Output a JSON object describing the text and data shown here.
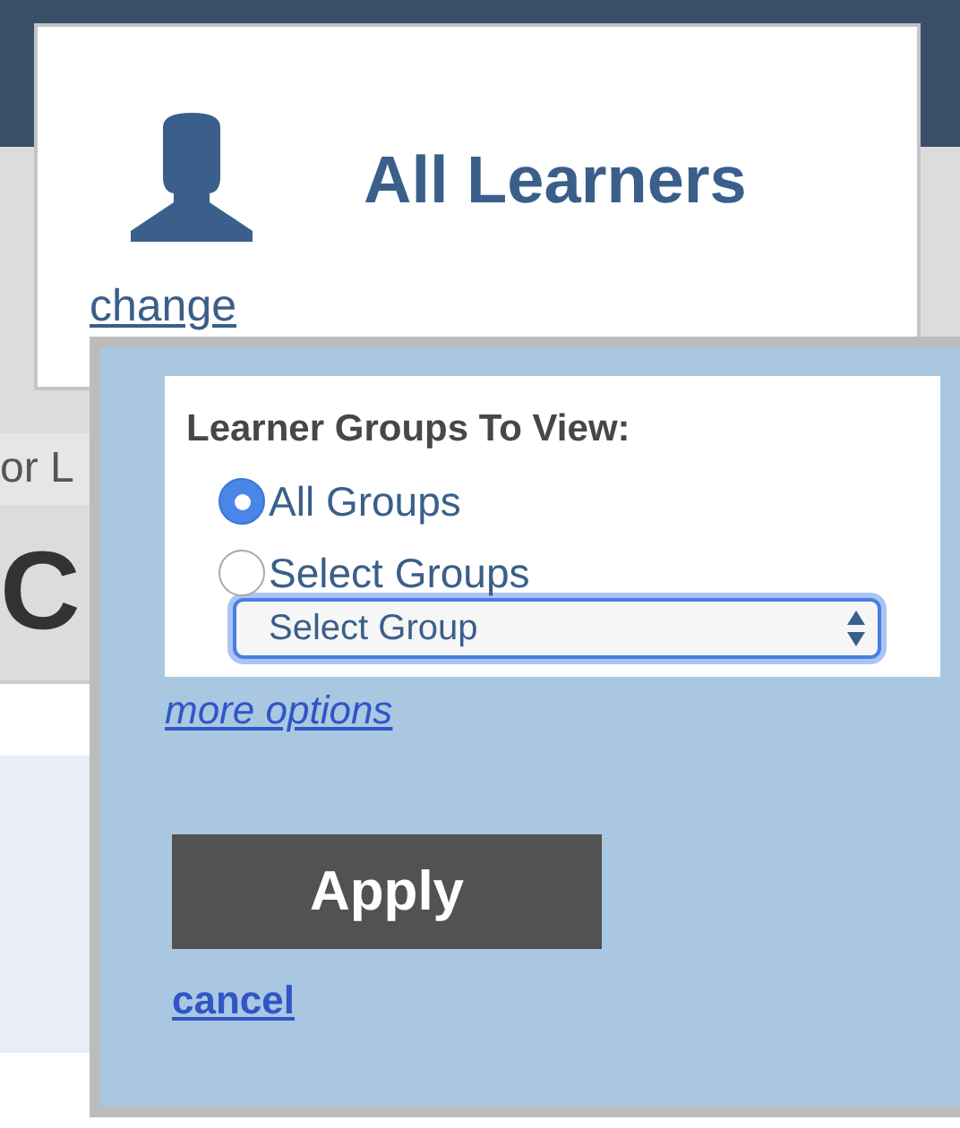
{
  "learner_card": {
    "title": "All Learners",
    "change_link": "change"
  },
  "background": {
    "subtitle": "or L",
    "heading": "C"
  },
  "popup": {
    "heading": "Learner Groups To View:",
    "options": [
      {
        "label": "All Groups",
        "selected": true
      },
      {
        "label": "Select Groups",
        "selected": false
      }
    ],
    "group_select": {
      "value": "Select Group"
    },
    "more_options": "more options",
    "apply_button": "Apply",
    "cancel_link": "cancel"
  }
}
